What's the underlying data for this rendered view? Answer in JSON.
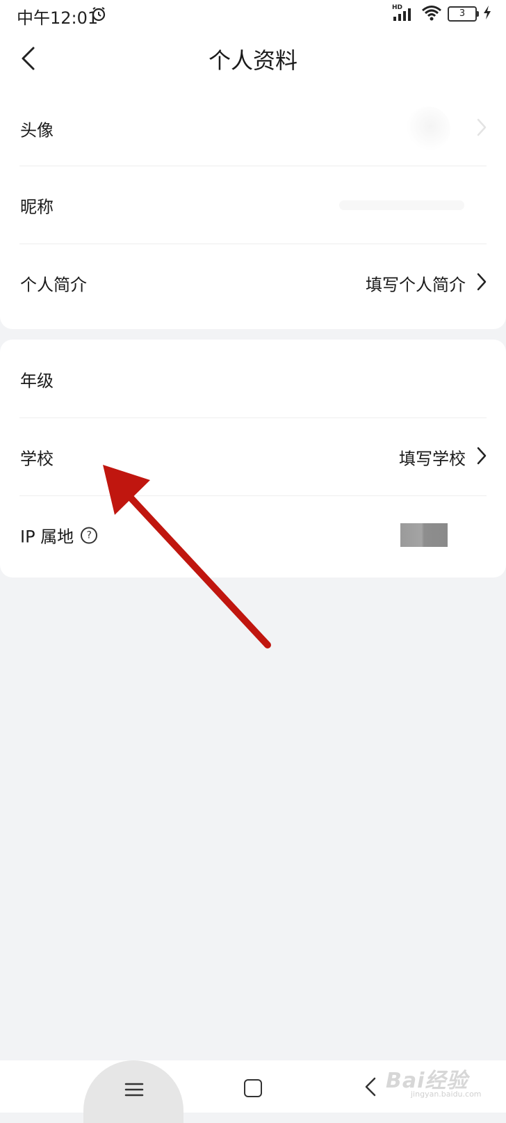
{
  "status_bar": {
    "time": "中午12:01",
    "network": "HD",
    "battery_level": "3",
    "icons": [
      "alarm-icon",
      "signal-icon",
      "wifi-icon",
      "battery-icon",
      "charging-icon"
    ]
  },
  "header": {
    "title": "个人资料",
    "back_icon": "chevron-left-icon"
  },
  "profile_section": {
    "rows": [
      {
        "label": "头像",
        "value": ""
      },
      {
        "label": "昵称",
        "value": ""
      },
      {
        "label": "个人简介",
        "value": "填写个人简介"
      }
    ]
  },
  "school_section": {
    "rows": [
      {
        "label": "年级",
        "value": ""
      },
      {
        "label": "学校",
        "value": "填写学校"
      },
      {
        "label": "IP 属地",
        "value": ""
      }
    ]
  },
  "annotation": {
    "arrow_color": "#c0160f"
  },
  "nav_bar": {
    "icons": [
      "menu-icon",
      "home-icon",
      "back-icon"
    ]
  },
  "watermark": {
    "text": "Bai经验",
    "sub": "jingyan.baidu.com"
  },
  "colors": {
    "background": "#f2f3f5",
    "card": "#ffffff",
    "text": "#1a1a1a"
  }
}
